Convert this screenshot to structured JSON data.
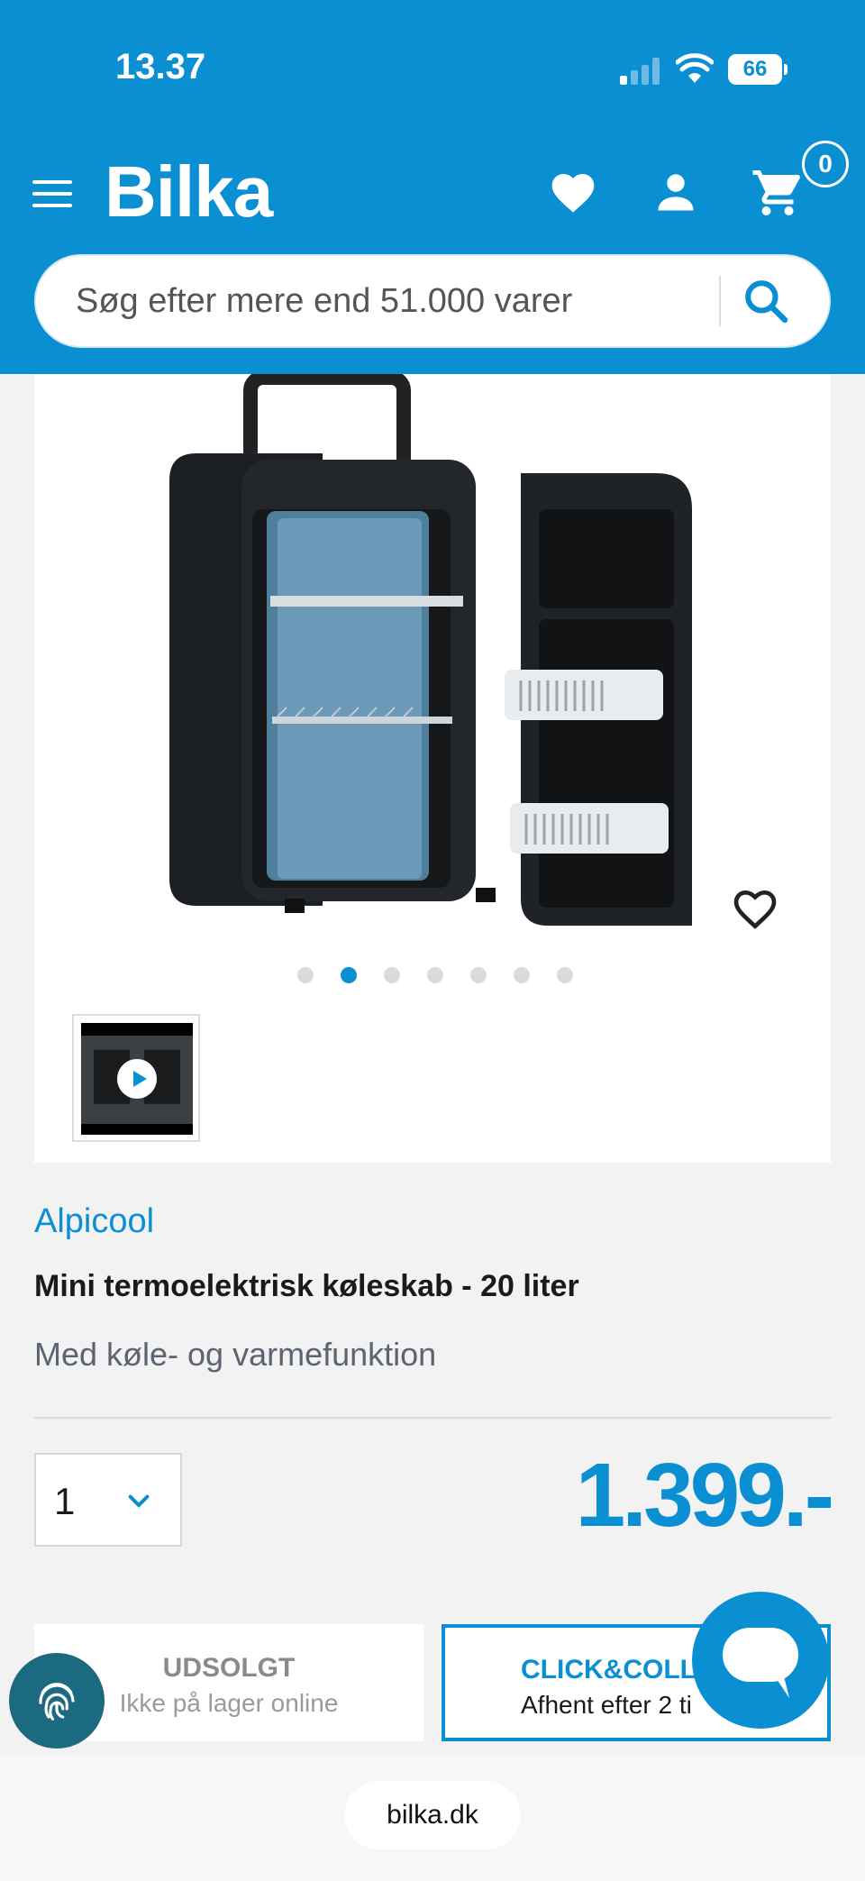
{
  "status_bar": {
    "time": "13.37",
    "battery": "66",
    "icons": [
      "signal-icon",
      "wifi-icon",
      "battery-icon"
    ]
  },
  "header": {
    "logo": "Bilka",
    "cart_count": "0",
    "icons": [
      "menu-icon",
      "heart-icon",
      "user-icon",
      "cart-icon"
    ],
    "brand_color": "#0a8fd2"
  },
  "search": {
    "placeholder": "Søg efter mere end 51.000 varer",
    "value": ""
  },
  "gallery": {
    "image_count": 7,
    "active_index": 1
  },
  "product": {
    "brand": "Alpicool",
    "title": "Mini termoelektrisk køleskab - 20 liter",
    "subtitle": "Med køle- og varmefunktion",
    "quantity": "1",
    "price": "1.399.-"
  },
  "delivery": {
    "online_status": "UDSOLGT",
    "online_sub": "Ikke på lager online",
    "cc_title": "CLICK&COLL",
    "cc_sub": "Afhent efter 2 ti"
  },
  "browser": {
    "url": "bilka.dk"
  }
}
